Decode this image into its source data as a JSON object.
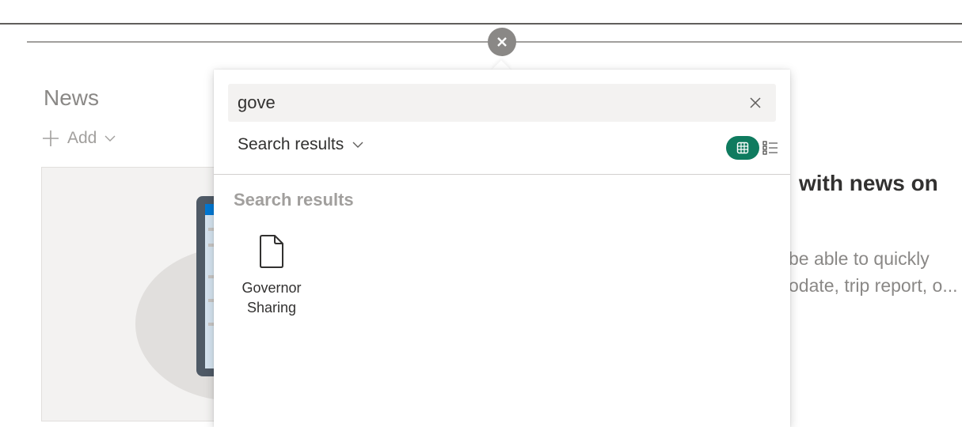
{
  "news": {
    "title": "News",
    "add_label": "Add"
  },
  "background": {
    "heading_fragment": "with news on",
    "body_line1": "be able to quickly",
    "body_line2": "odate, trip report, o..."
  },
  "picker": {
    "search": {
      "value": "gove",
      "clear_icon": "close-icon"
    },
    "filter": {
      "selected": "Search results"
    },
    "view_modes": {
      "grid_icon": "grid-icon",
      "list_icon": "list-icon",
      "active": "grid",
      "accent_color": "#0f7b5f"
    },
    "results_heading": "Search results",
    "results": [
      {
        "name": "Governor Sharing",
        "icon": "file-icon"
      }
    ]
  }
}
